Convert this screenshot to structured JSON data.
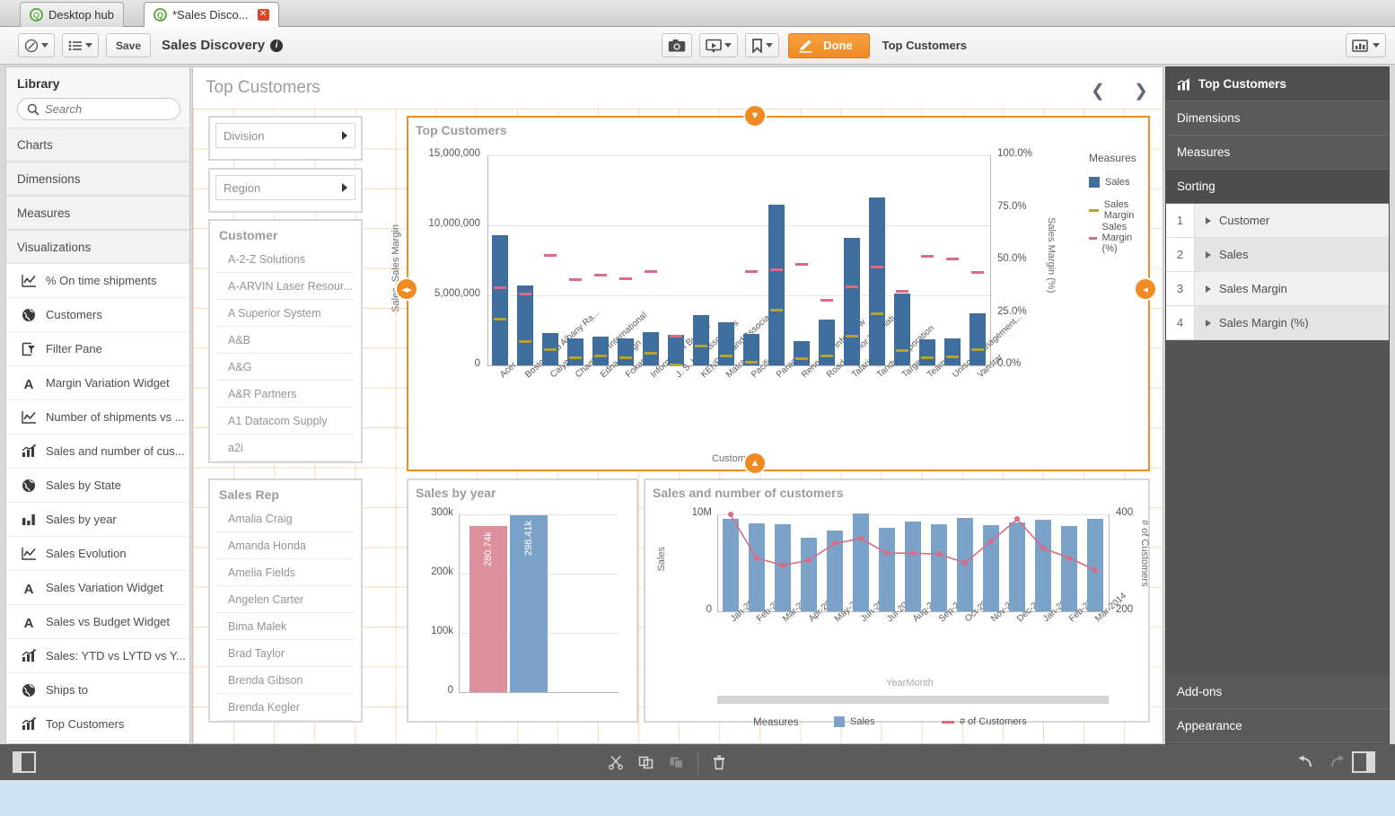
{
  "window": {
    "tabs": [
      {
        "label": "Desktop hub",
        "active": false,
        "closable": false
      },
      {
        "label": "*Sales Disco...",
        "active": true,
        "closable": true
      }
    ]
  },
  "toolbar": {
    "nav_icon": "compass-icon",
    "sheets_icon": "sheet-list-icon",
    "save_label": "Save",
    "app_title": "Sales Discovery",
    "info_glyph": "i",
    "snapshot_icon": "camera-icon",
    "story_icon": "play-screen-icon",
    "bookmark_icon": "bookmark-icon",
    "done_label": "Done",
    "edit_icon": "pencil-icon",
    "edit_context_title": "Top Customers",
    "right_icon": "charts-panel-icon"
  },
  "library": {
    "title": "Library",
    "search": {
      "placeholder": "Search",
      "value": ""
    },
    "sections": [
      "Charts",
      "Dimensions",
      "Measures",
      "Visualizations"
    ],
    "items": [
      {
        "label": "% On time shipments",
        "icon": "line-chart-icon"
      },
      {
        "label": "Customers",
        "icon": "map-icon"
      },
      {
        "label": "Filter Pane",
        "icon": "filter-pane-icon"
      },
      {
        "label": "Margin Variation Widget",
        "icon": "text-A-icon"
      },
      {
        "label": "Number of shipments vs ...",
        "icon": "line-chart-icon"
      },
      {
        "label": "Sales and number of cus...",
        "icon": "combo-chart-icon"
      },
      {
        "label": "Sales by State",
        "icon": "map-icon"
      },
      {
        "label": "Sales by year",
        "icon": "bar-chart-icon"
      },
      {
        "label": "Sales Evolution",
        "icon": "line-chart-icon"
      },
      {
        "label": "Sales Variation Widget",
        "icon": "text-A-icon"
      },
      {
        "label": "Sales vs Budget Widget",
        "icon": "text-A-icon"
      },
      {
        "label": "Sales: YTD vs LYTD vs Y...",
        "icon": "combo-chart-icon"
      },
      {
        "label": "Ships to",
        "icon": "map-icon"
      },
      {
        "label": "Top Customers",
        "icon": "combo-chart-icon"
      }
    ]
  },
  "sheet": {
    "title": "Top Customers",
    "prev_icon": "chevron-left-icon",
    "next_icon": "chevron-right-icon",
    "filters": [
      {
        "label": "Division",
        "expand_icon": "triangle-right-icon"
      },
      {
        "label": "Region",
        "expand_icon": "triangle-right-icon"
      }
    ],
    "customer_list": {
      "title": "Customer",
      "values": [
        "A-2-Z Solutions",
        "A-ARVIN Laser Resour...",
        "A Superior System",
        "A&B",
        "A&G",
        "A&R Partners",
        "A1 Datacom Supply",
        "a2i"
      ]
    },
    "salesrep_list": {
      "title": "Sales Rep",
      "values": [
        "Amalia Craig",
        "Amanda Honda",
        "Amelia Fields",
        "Angelen Carter",
        "Bima Malek",
        "Brad Taylor",
        "Brenda Gibson",
        "Brenda Kegler"
      ]
    }
  },
  "right_panel": {
    "header": "Top Customers",
    "header_icon": "combo-chart-icon",
    "sections": [
      {
        "label": "Dimensions",
        "active": false
      },
      {
        "label": "Measures",
        "active": false
      },
      {
        "label": "Sorting",
        "active": true
      }
    ],
    "sorting_rows": [
      {
        "index": "1",
        "label": "Customer"
      },
      {
        "index": "2",
        "label": "Sales"
      },
      {
        "index": "3",
        "label": "Sales Margin"
      },
      {
        "index": "4",
        "label": "Sales Margin (%)"
      }
    ],
    "bottom_sections": [
      {
        "label": "Add-ons"
      },
      {
        "label": "Appearance"
      }
    ]
  },
  "bottom_toolbar": {
    "left_panel_icon": "left-panel-toggle-icon",
    "cut_icon": "scissors-icon",
    "copy_icon": "copy-icon",
    "paste_icon": "paste-icon",
    "delete_icon": "trash-icon",
    "undo_icon": "undo-arrow-icon",
    "redo_icon": "redo-arrow-icon",
    "right_panel_icon": "right-panel-toggle-icon"
  },
  "colors": {
    "accent": "#ef8b22",
    "bar_blue": "#3d6e9e",
    "bar_light_blue": "#7ba3c9",
    "bar_pink": "#dd8f9c",
    "margin_olive": "#b5a530",
    "margin_pct_pink": "#d96b84",
    "panel_dark": "#555555"
  },
  "chart_data": [
    {
      "type": "bar",
      "title": "Top Customers",
      "xlabel": "Customer",
      "ylabel": "Sales, Sales Margin",
      "y2label": "Sales Margin (%)",
      "ylim": [
        0,
        15000000
      ],
      "yticks": [
        "0",
        "5,000,000",
        "10,000,000",
        "15,000,000"
      ],
      "y2lim": [
        0,
        100
      ],
      "y2ticks": [
        "0.0%",
        "25.0%",
        "50.0%",
        "75.0%",
        "100.0%"
      ],
      "grid": true,
      "legend_title": "Measures",
      "legend": [
        "Sales",
        "Sales Margin",
        "Sales Margin (%)"
      ],
      "categories": [
        "Acer",
        "Boston and Albany Ra...",
        "Calypso",
        "Champion International",
        "Edna Design",
        "Fokas",
        "Information Bureau",
        "J. S. Lee Associates",
        "KENROB and Associa...",
        "Matradi",
        "Pacifico",
        "Paracel",
        "Renegade Info Crew",
        "Road Warrior Internati...",
        "Talarian",
        "Tandy Corporation",
        "Target",
        "Teammax",
        "Unison Management...",
        "Vanstar"
      ],
      "series": [
        {
          "name": "Sales",
          "values": [
            9300000,
            5700000,
            2300000,
            1950000,
            2050000,
            1950000,
            2400000,
            2150000,
            3600000,
            3050000,
            2250000,
            11500000,
            1750000,
            3300000,
            9100000,
            12000000,
            5150000,
            1850000,
            1900000,
            3700000
          ]
        },
        {
          "name": "Sales Margin",
          "values": [
            3400000,
            1800000,
            1200000,
            650000,
            750000,
            650000,
            950000,
            150000,
            1500000,
            800000,
            350000,
            4050000,
            550000,
            800000,
            2150000,
            3800000,
            1150000,
            650000,
            700000,
            1250000
          ]
        },
        {
          "name": "Sales Margin (%)",
          "values": [
            37.8,
            34.6,
            53.0,
            41.6,
            43.5,
            42.0,
            45.3,
            14.5,
            null,
            null,
            45.5,
            46.0,
            48.9,
            31.5,
            38.0,
            47.5,
            35.9,
            52.5,
            51.2,
            45.0
          ]
        }
      ]
    },
    {
      "type": "bar",
      "title": "Sales by year",
      "ylim": [
        0,
        300000
      ],
      "yticks": [
        "0",
        "100k",
        "200k",
        "300k"
      ],
      "categories": [
        "",
        ""
      ],
      "values": [
        280740,
        298410
      ],
      "data_labels": [
        "280.74k",
        "298.41k"
      ],
      "colors": [
        "#dd8f9c",
        "#7ba3c9"
      ]
    },
    {
      "type": "combo",
      "title": "Sales and number of customers",
      "xlabel": "YearMonth",
      "ylabel": "Sales",
      "y2label": "# of Customers",
      "ylim": [
        0,
        10000000
      ],
      "yticks": [
        "0",
        "10M"
      ],
      "y2lim": [
        200,
        400
      ],
      "y2ticks": [
        "200",
        "400"
      ],
      "legend_title": "Measures",
      "legend": [
        "Sales",
        "# of Customers"
      ],
      "categories": [
        "Jan-2013",
        "Feb-2013",
        "Mar-2013",
        "Apr-2013",
        "May-2013",
        "Jun-2013",
        "Jul-2013",
        "Aug-2013",
        "Sep-2013",
        "Oct-2013",
        "Nov-2013",
        "Dec-2013",
        "Jan-2014",
        "Feb-2014",
        "Mar-2014"
      ],
      "series": [
        {
          "name": "Sales",
          "values": [
            9500000,
            9100000,
            9000000,
            7600000,
            8300000,
            10100000,
            8600000,
            9300000,
            9000000,
            9600000,
            8900000,
            9200000,
            9400000,
            8800000,
            9500000
          ]
        },
        {
          "name": "# of Customers",
          "values": [
            400,
            310,
            295,
            305,
            340,
            350,
            320,
            320,
            318,
            300,
            345,
            390,
            330,
            310,
            285
          ]
        }
      ]
    }
  ]
}
